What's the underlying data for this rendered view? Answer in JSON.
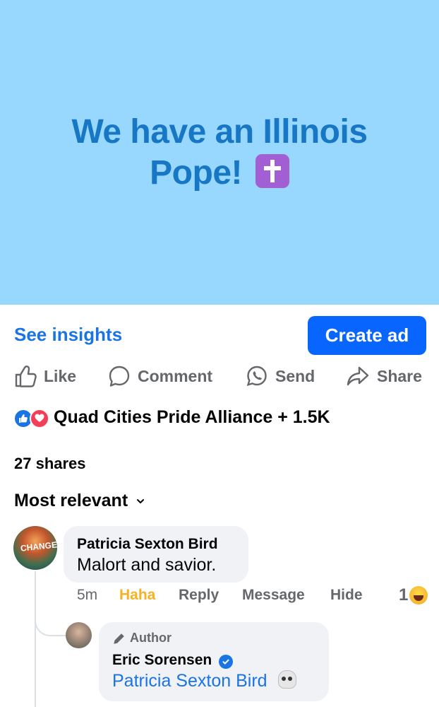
{
  "post": {
    "banner_text": "We have an Illinois Pope!",
    "banner_emoji": "latin-cross-emoji",
    "banner_bg": "#99d8fe",
    "banner_fg": "#1877c4"
  },
  "toolbar": {
    "insights_label": "See insights",
    "create_ad_label": "Create ad"
  },
  "actions": {
    "like": "Like",
    "comment": "Comment",
    "send": "Send",
    "share": "Share"
  },
  "reactions": {
    "icons": [
      "like-reaction-icon",
      "love-reaction-icon"
    ],
    "summary": "Quad Cities Pride Alliance + 1.5K"
  },
  "shares": "27 shares",
  "sort": {
    "label": "Most relevant"
  },
  "comments": [
    {
      "author": "Patricia Sexton Bird",
      "avatar_text": "CHANGE",
      "text": "Malort and savior.",
      "time": "5m",
      "reaction_label": "Haha",
      "reply_label": "Reply",
      "message_label": "Message",
      "hide_label": "Hide",
      "reaction_count": "1",
      "reaction_icon": "haha-emoji",
      "replies": [
        {
          "badge": "Author",
          "author": "Eric Sorensen",
          "verified": true,
          "mention": "Patricia Sexton Bird",
          "emoji": "skull-emoji"
        }
      ]
    }
  ],
  "colors": {
    "accent": "#0866ff",
    "link": "#1b74e4",
    "haha": "#f7b125",
    "muted": "#65676b"
  }
}
